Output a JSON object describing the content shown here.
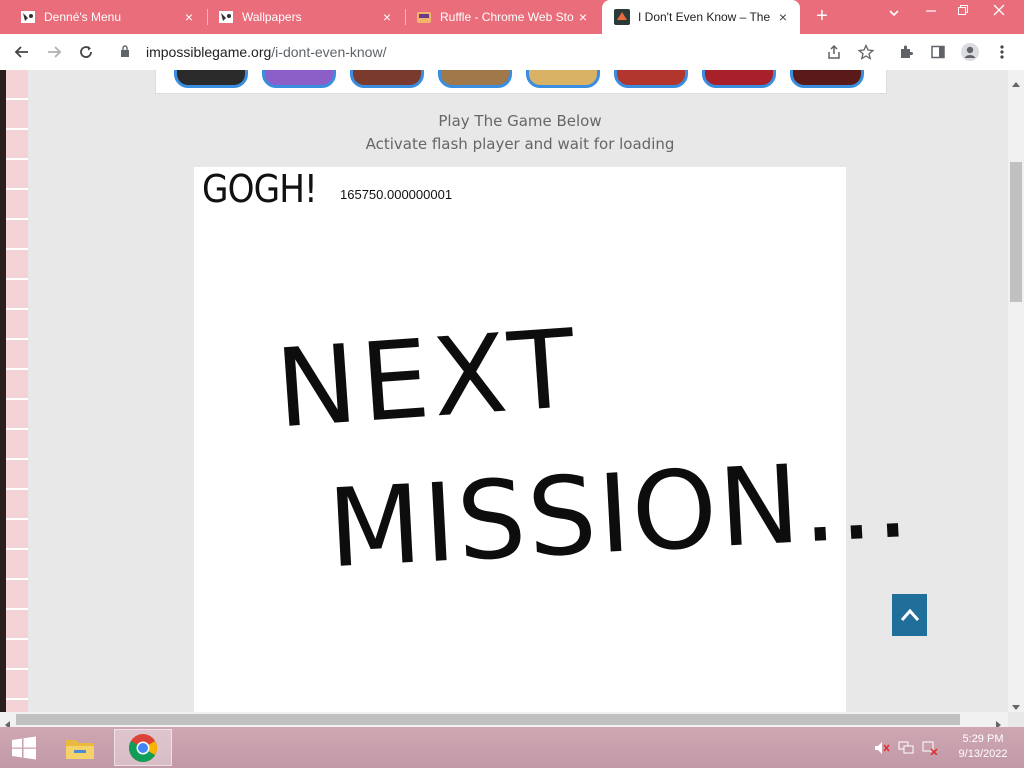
{
  "tabs": [
    {
      "title": "Denné's Menu",
      "close": "×",
      "icon": "game-controller-icon",
      "active": false
    },
    {
      "title": "Wallpapers",
      "close": "×",
      "icon": "game-controller-icon",
      "active": false
    },
    {
      "title": "Ruffle - Chrome Web Store",
      "close": "×",
      "icon": "ruffle-icon",
      "active": false
    },
    {
      "title": "I Don't Even Know – The",
      "close": "×",
      "icon": "site-favicon",
      "active": true
    }
  ],
  "new_tab": "+",
  "toolbar": {
    "url_domain": "impossiblegame.org",
    "url_path": "/i-dont-even-know/"
  },
  "page": {
    "play_heading": "Play The Game Below",
    "play_sub": "Activate flash player and wait for loading"
  },
  "game": {
    "logo": "GOGH!",
    "score": "165750.000000001",
    "line1": "NEXT",
    "line2": "MISSION..."
  },
  "taskbar": {
    "time": "5:29 PM",
    "date": "9/13/2022"
  },
  "colors": {
    "tab_bar": "#e96d7a",
    "taskbar": "#c29aa7",
    "to_top_button": "#1f6f9a"
  }
}
